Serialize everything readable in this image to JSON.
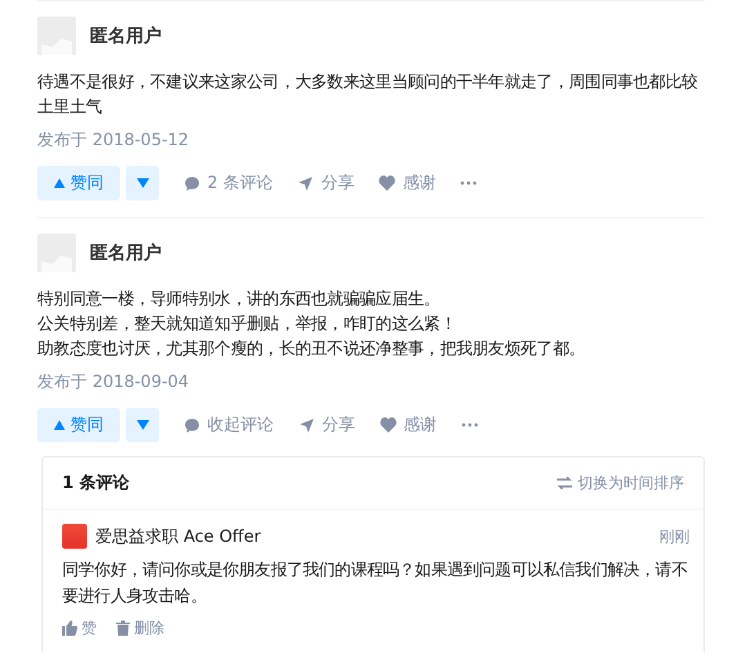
{
  "answers": [
    {
      "author": "匿名用户",
      "paragraphs": [
        "待遇不是很好，不建议来这家公司，大多数来这里当顾问的干半年就走了，周围同事也都比较土里土气"
      ],
      "date": "发布于 2018-05-12",
      "vote_label": "赞同",
      "voted": false,
      "actions": [
        {
          "kind": "comment",
          "label": "2 条评论"
        },
        {
          "kind": "share",
          "label": "分享"
        },
        {
          "kind": "thanks",
          "label": "感谢"
        },
        {
          "kind": "more"
        }
      ]
    },
    {
      "author": "匿名用户",
      "paragraphs": [
        "特别同意一楼，导师特别水，讲的东西也就骗骗应届生。",
        "公关特别差，整天就知道知乎删贴，举报，咋盯的这么紧！",
        "助教态度也讨厌，尤其那个瘦的，长的丑不说还净整事，把我朋友烦死了都。"
      ],
      "date": "发布于 2018-09-04",
      "vote_label": "赞同",
      "voted": false,
      "actions": [
        {
          "kind": "comment",
          "label": "收起评论"
        },
        {
          "kind": "share",
          "label": "分享"
        },
        {
          "kind": "thanks",
          "label": "感谢"
        },
        {
          "kind": "more"
        }
      ],
      "comments_panel": {
        "count": "1 条评论",
        "sort": "切换为时间排序",
        "comments": [
          {
            "author": "爱思益求职 Ace Offer",
            "time": "刚刚",
            "text": "同学你好，请问你或是你朋友报了我们的课程吗？如果遇到问题可以私信我们解决，请不要进行人身攻击哈。",
            "actions": [
              {
                "kind": "like",
                "label": "赞"
              },
              {
                "kind": "delete",
                "label": "删除"
              }
            ]
          }
        ]
      }
    }
  ]
}
